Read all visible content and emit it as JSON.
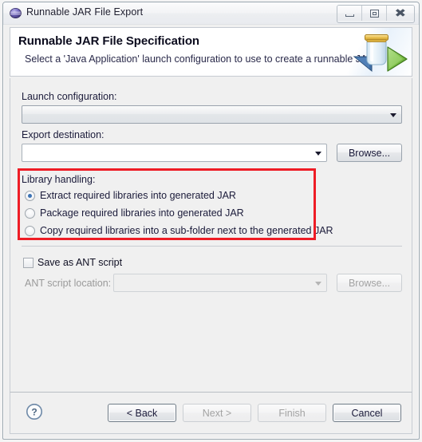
{
  "window": {
    "title": "Runnable JAR File Export",
    "title_icon": "eclipse-sphere-icon",
    "controls": {
      "minimize": "minimize-icon",
      "maximize": "maximize-icon",
      "close": "close-icon"
    }
  },
  "header": {
    "title": "Runnable JAR File Specification",
    "description": "Select a 'Java Application' launch configuration to use to create a runnable JAR.",
    "icon": "jar-with-green-play-icon"
  },
  "form": {
    "launch_configuration": {
      "label": "Launch configuration:",
      "value": "",
      "state": "readonly"
    },
    "export_destination": {
      "label": "Export destination:",
      "value": "",
      "placeholder": "",
      "browse_label": "Browse...",
      "state": "enabled"
    },
    "library_handling": {
      "label": "Library handling:",
      "options": [
        {
          "label": "Extract required libraries into generated JAR",
          "selected": true
        },
        {
          "label": "Package required libraries into generated JAR",
          "selected": false
        },
        {
          "label": "Copy required libraries into a sub-folder next to the generated JAR",
          "selected": false
        }
      ]
    },
    "save_as_ant": {
      "label": "Save as ANT script",
      "checked": false
    },
    "ant_script_location": {
      "label": "ANT script location:",
      "value": "",
      "browse_label": "Browse...",
      "state": "disabled"
    }
  },
  "footer": {
    "help_icon": "help-question-icon",
    "buttons": [
      {
        "label": "< Back",
        "state": "enabled"
      },
      {
        "label": "Next >",
        "state": "disabled"
      },
      {
        "label": "Finish",
        "state": "disabled"
      },
      {
        "label": "Cancel",
        "state": "default"
      }
    ]
  },
  "annotation": {
    "color": "#ee1c25",
    "target": "library-handling-group"
  }
}
